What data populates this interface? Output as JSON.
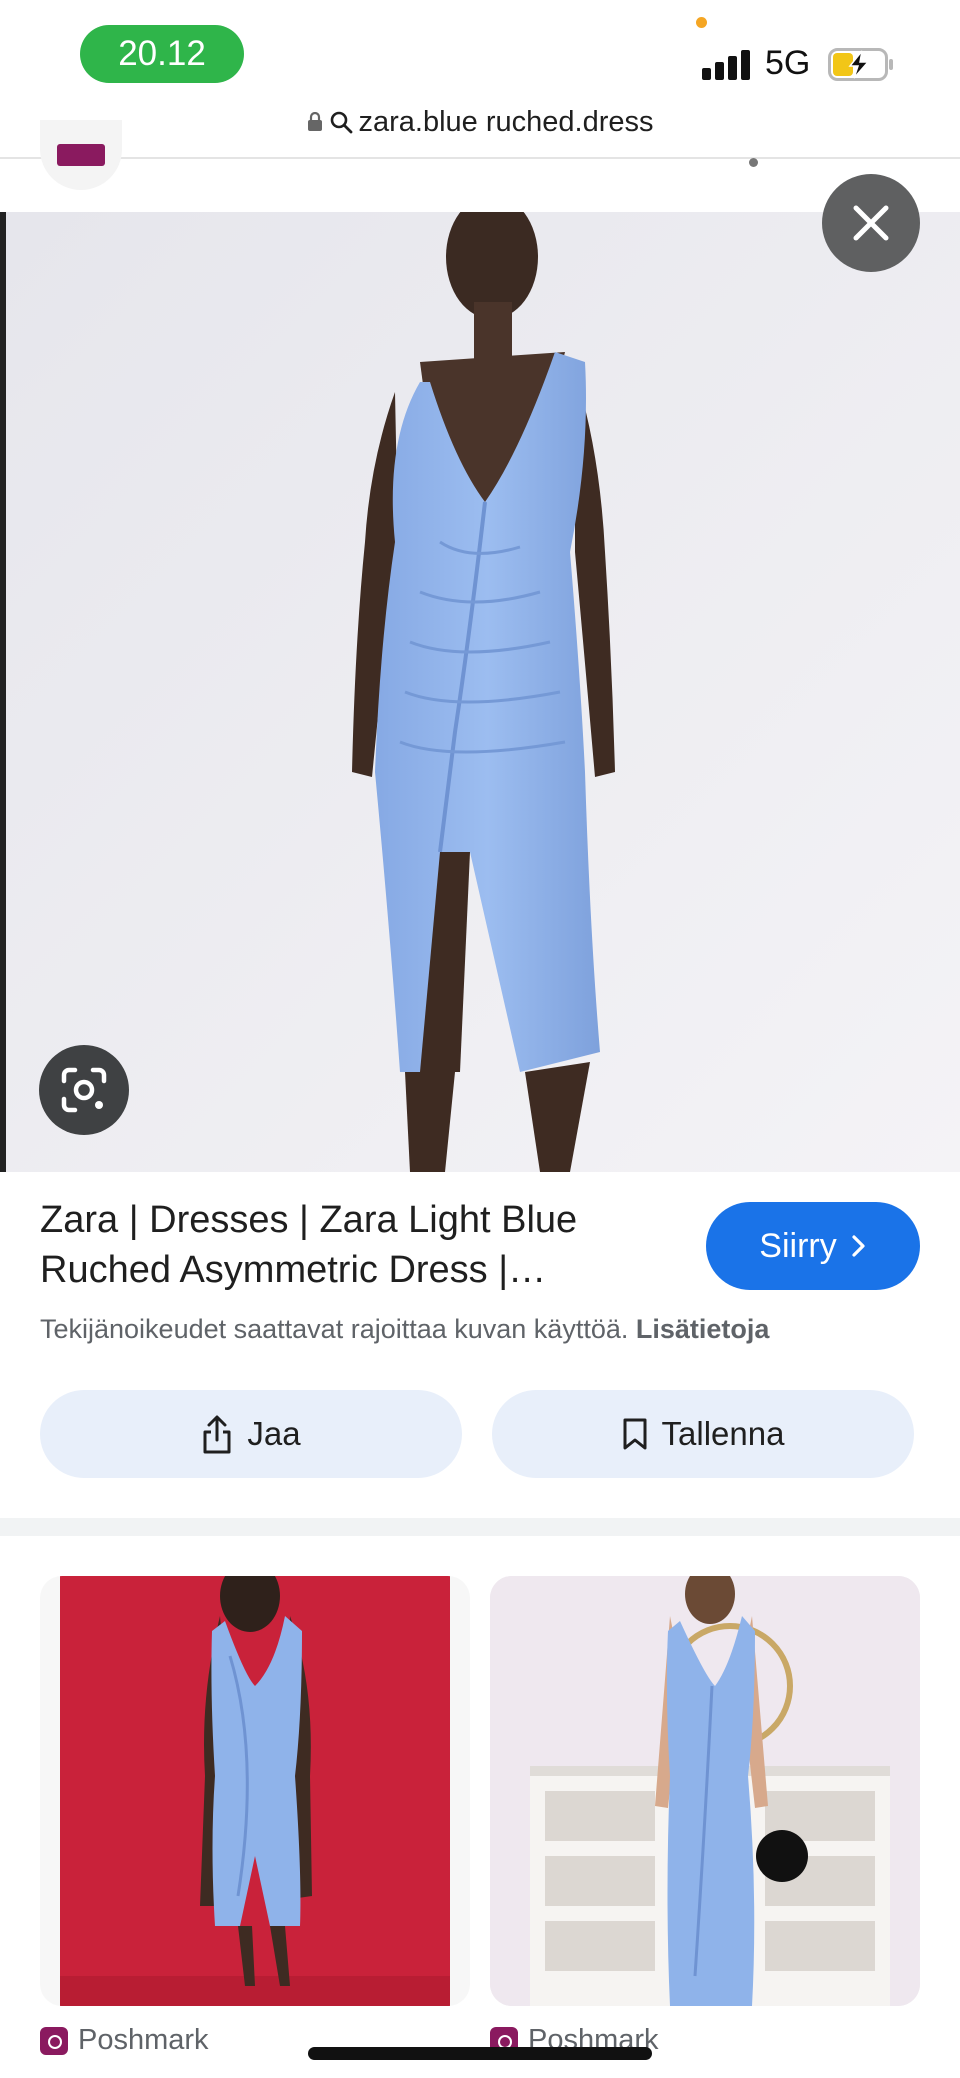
{
  "status": {
    "time": "20.12",
    "network": "5G"
  },
  "browser": {
    "url": "zara.blue ruched.dress"
  },
  "icons": {
    "lock": "lock-icon",
    "search": "search-icon",
    "close": "close-icon",
    "lens": "lens-icon",
    "chevron": "chevron-right-icon",
    "share": "share-icon",
    "bookmark": "bookmark-icon"
  },
  "result": {
    "title": "Zara | Dresses | Zara Light Blue Ruched Asymmetric Dress |…",
    "visit_label": "Siirry",
    "copyright_text": "Tekijänoikeudet saattavat rajoittaa kuvan käyttöä.",
    "more_info_label": "Lisätietoja",
    "share_label": "Jaa",
    "save_label": "Tallenna"
  },
  "related": [
    {
      "source": "Poshmark"
    },
    {
      "source": "Poshmark"
    }
  ],
  "colors": {
    "accent": "#1a73e8",
    "pill_bg": "#e8effa",
    "time_pill": "#2fb54a",
    "dress_blue": "#8fb3ea"
  }
}
